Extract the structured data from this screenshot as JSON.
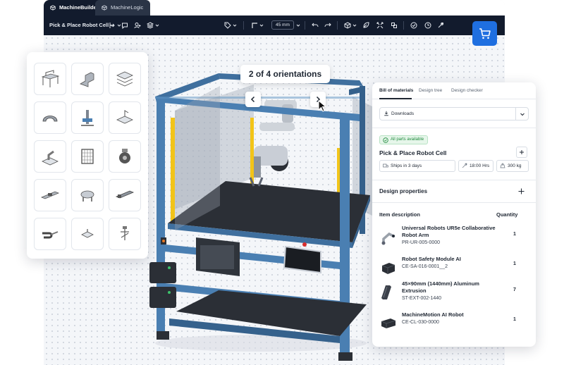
{
  "tabs": [
    {
      "label": "MachineBuilder",
      "active": true
    },
    {
      "label": "MachineLogic",
      "active": false
    }
  ],
  "toolbar": {
    "project_title": "Pick & Place Robot Cell",
    "zoom": "45 mm"
  },
  "colors": {
    "toolbar_bg": "#121b2d",
    "accent": "#1f6fe0",
    "frame_blue": "#3f6f9e",
    "safety_yellow": "#f2c418",
    "success_green": "#1f8a3d"
  },
  "viewer": {
    "orientation_label": "2 of 4 orientations"
  },
  "palette_icons": [
    "workbench-icon",
    "bracket-icon",
    "layers-icon",
    "handle-icon",
    "gantry-icon",
    "conveyor-plate-icon",
    "robot-arm-icon",
    "grid-panel-icon",
    "wheel-icon",
    "rail-icon",
    "gripper-icon",
    "linear-actuator-icon",
    "cable-chain-icon",
    "clamp-icon",
    "fastener-icon"
  ],
  "panel": {
    "tabs": [
      "Bill of materials",
      "Design tree",
      "Design checker"
    ],
    "download_label": "Downloads",
    "parts_badge": "All parts available",
    "product_name": "Pick & Place Robot Cell",
    "ship_label": "Ships in 3 days",
    "hours_label": "18:00 Hrs",
    "weight_label": "300 kg",
    "design_properties": "Design properties",
    "col_item": "Item description",
    "col_qty": "Quantity",
    "items": [
      {
        "name": "Universal Robots UR5e Collaborative Robot Arm",
        "sku": "PR-UR-005-0000",
        "qty": "1"
      },
      {
        "name": "Robot Safety Module AI",
        "sku": "CE-SA-016-0001__2",
        "qty": "1"
      },
      {
        "name": "45×90mm (1440mm) Aluminum Extrusion",
        "sku": "ST-EXT-002-1440",
        "qty": "7"
      },
      {
        "name": "MachineMotion AI Robot",
        "sku": "CE-CL-030-0000",
        "qty": "1"
      }
    ]
  }
}
